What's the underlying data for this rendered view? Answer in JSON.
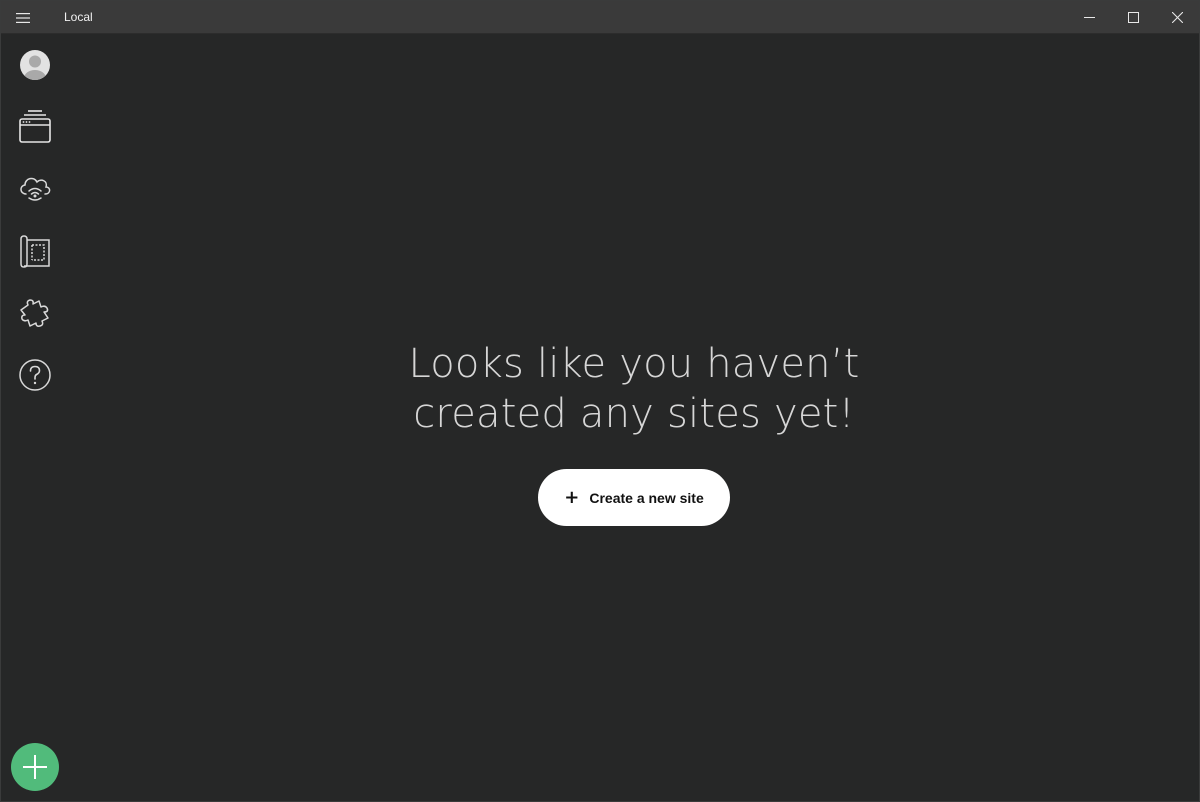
{
  "app": {
    "title": "Local"
  },
  "window_controls": {
    "minimize_icon": "minimize-icon",
    "maximize_icon": "maximize-icon",
    "close_icon": "close-icon"
  },
  "sidebar": {
    "items": [
      {
        "id": "account",
        "icon": "user-avatar-icon"
      },
      {
        "id": "sites",
        "icon": "local-sites-icon"
      },
      {
        "id": "connect",
        "icon": "cloud-connect-icon"
      },
      {
        "id": "blueprints",
        "icon": "blueprint-icon"
      },
      {
        "id": "addons",
        "icon": "puzzle-icon"
      },
      {
        "id": "help",
        "icon": "help-icon"
      }
    ],
    "add_button_icon": "plus-icon"
  },
  "empty_state": {
    "headline_line1": "Looks like you haven’t",
    "headline_line2": "created any sites yet!",
    "button_plus": "+",
    "button_label": "Create a new site"
  },
  "colors": {
    "background": "#262727",
    "titlebar": "#3a3a3a",
    "accent_green": "#51bb7b",
    "headline_text": "#d6d6d6",
    "button_bg": "#ffffff"
  }
}
